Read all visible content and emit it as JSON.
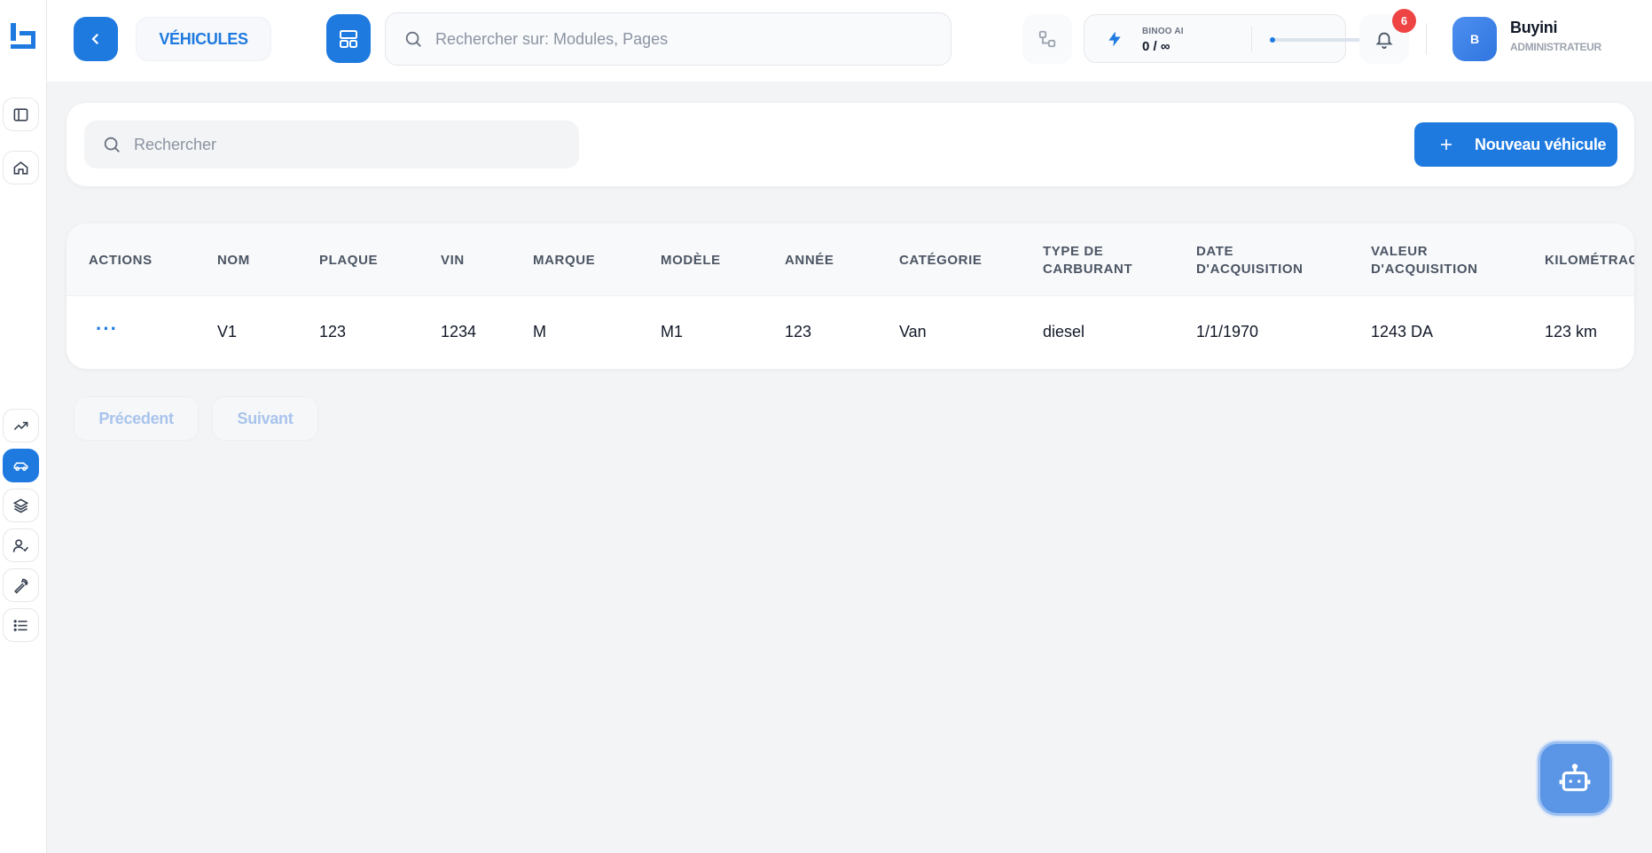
{
  "header": {
    "breadcrumb": "VÉHICULES",
    "search_placeholder": "Rechercher sur: Modules, Pages",
    "ai_label": "BINOO AI",
    "ai_usage": "0 / ∞",
    "ai_usage_fraction": 0.05,
    "notification_count": "6",
    "user_initial": "B",
    "user_name": "Buyini",
    "user_role": "ADMINISTRATEUR"
  },
  "rail": {
    "icons": [
      "logo-icon",
      "sidebar-toggle-icon",
      "home-icon",
      "trending-icon",
      "car-icon",
      "layers-icon",
      "user-check-icon",
      "wrench-icon",
      "list-icon"
    ],
    "active": "car-icon"
  },
  "toolbar": {
    "search_placeholder": "Rechercher",
    "new_label": "Nouveau véhicule"
  },
  "table": {
    "columns": [
      "ACTIONS",
      "NOM",
      "PLAQUE",
      "VIN",
      "MARQUE",
      "MODÈLE",
      "ANNÉE",
      "CATÉGORIE",
      "TYPE DE\nCARBURANT",
      "DATE\nD'ACQUISITION",
      "VALEUR\nD'ACQUISITION",
      "KILOMÉTRAG"
    ],
    "rows": [
      {
        "actions": "···",
        "nom": "V1",
        "plaque": "123",
        "vin": "1234",
        "marque": "M",
        "modele": "M1",
        "annee": "123",
        "categorie": "Van",
        "carburant": "diesel",
        "date_acquisition": "1/1/1970",
        "valeur_acquisition": "1243 DA",
        "kilometrage": "123 km"
      }
    ]
  },
  "pagination": {
    "prev_label": "Précedent",
    "next_label": "Suivant"
  },
  "colors": {
    "accent": "#1f7ae0",
    "badge": "#ef4444",
    "background": "#f3f4f6"
  }
}
